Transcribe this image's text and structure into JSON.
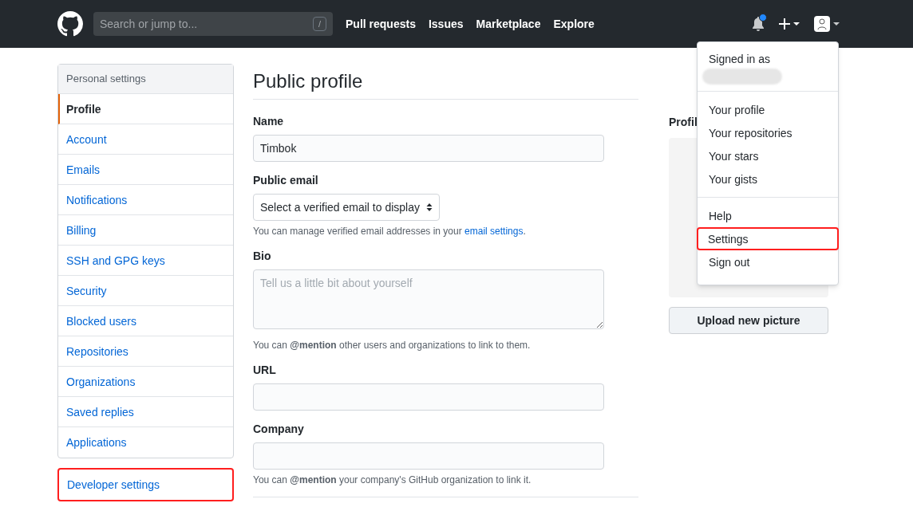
{
  "header": {
    "search": {
      "placeholder": "Search or jump to...",
      "shortcut": "/"
    },
    "nav": [
      "Pull requests",
      "Issues",
      "Marketplace",
      "Explore"
    ],
    "notifications": {
      "unread": true
    }
  },
  "sidebar": {
    "title": "Personal settings",
    "items": [
      {
        "label": "Profile",
        "selected": true
      },
      {
        "label": "Account",
        "selected": false
      },
      {
        "label": "Emails",
        "selected": false
      },
      {
        "label": "Notifications",
        "selected": false
      },
      {
        "label": "Billing",
        "selected": false
      },
      {
        "label": "SSH and GPG keys",
        "selected": false
      },
      {
        "label": "Security",
        "selected": false
      },
      {
        "label": "Blocked users",
        "selected": false
      },
      {
        "label": "Repositories",
        "selected": false
      },
      {
        "label": "Organizations",
        "selected": false
      },
      {
        "label": "Saved replies",
        "selected": false
      },
      {
        "label": "Applications",
        "selected": false
      }
    ],
    "developer": {
      "label": "Developer settings",
      "highlighted": true
    }
  },
  "main": {
    "title": "Public profile",
    "fields": [
      {
        "kind": "text",
        "label": "Name",
        "value": "Timbok"
      },
      {
        "kind": "select",
        "label": "Public email",
        "value": "Select a verified email to display",
        "note": {
          "text": "You can manage verified email addresses in your ",
          "link": "email settings",
          "after": "."
        }
      },
      {
        "kind": "textarea",
        "label": "Bio",
        "placeholder": "Tell us a little bit about yourself",
        "note": {
          "text": "You can **@mention** other users and organizations to link to them."
        }
      },
      {
        "kind": "text",
        "label": "URL"
      },
      {
        "kind": "text",
        "label": "Company",
        "note": {
          "text": "You can **@mention** your company's GitHub organization to link it."
        }
      }
    ]
  },
  "picture": {
    "heading": "Profil",
    "button": "Upload new picture"
  },
  "menu": {
    "signed_in": "Signed in as",
    "groups": [
      [
        {
          "label": "Your profile",
          "highlighted": false
        },
        {
          "label": "Your repositories",
          "highlighted": false
        },
        {
          "label": "Your stars",
          "highlighted": false
        },
        {
          "label": "Your gists",
          "highlighted": false
        }
      ],
      [
        {
          "label": "Help",
          "highlighted": false
        },
        {
          "label": "Settings",
          "highlighted": true
        },
        {
          "label": "Sign out",
          "highlighted": false
        }
      ]
    ]
  }
}
